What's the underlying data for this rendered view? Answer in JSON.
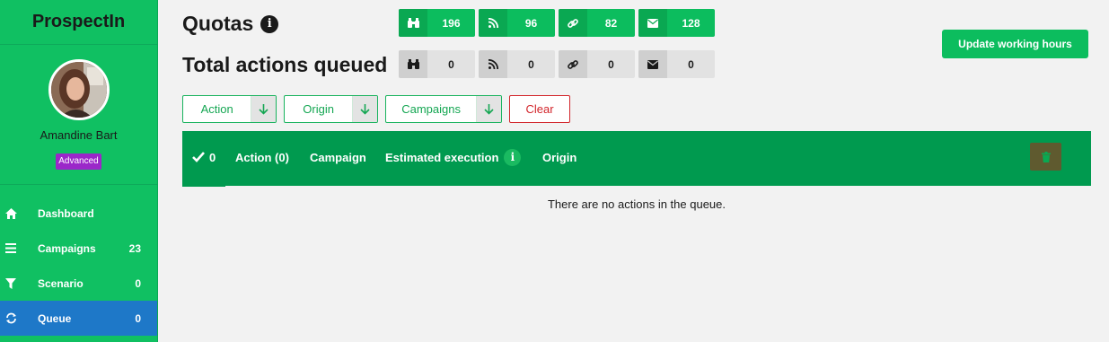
{
  "app": {
    "brand": "ProspectIn"
  },
  "profile": {
    "name": "Amandine Bart",
    "plan": "Advanced"
  },
  "nav": [
    {
      "label": "Dashboard",
      "count": "",
      "icon": "home-icon"
    },
    {
      "label": "Campaigns",
      "count": "23",
      "icon": "list-icon"
    },
    {
      "label": "Scenario",
      "count": "0",
      "icon": "filter-icon"
    },
    {
      "label": "Queue",
      "count": "0",
      "icon": "refresh-icon",
      "active": true
    }
  ],
  "quotas": {
    "title": "Quotas",
    "info": "i",
    "items": [
      {
        "icon": "binoculars-icon",
        "value": "196"
      },
      {
        "icon": "rss-icon",
        "value": "96"
      },
      {
        "icon": "link-icon",
        "value": "82"
      },
      {
        "icon": "envelope-icon",
        "value": "128"
      }
    ]
  },
  "queued": {
    "title": "Total actions queued",
    "items": [
      {
        "icon": "binoculars-icon",
        "value": "0"
      },
      {
        "icon": "rss-icon",
        "value": "0"
      },
      {
        "icon": "link-icon",
        "value": "0"
      },
      {
        "icon": "envelope-icon",
        "value": "0"
      }
    ]
  },
  "update_button": "Update working hours",
  "filters": {
    "action": "Action",
    "origin": "Origin",
    "campaigns": "Campaigns",
    "clear": "Clear"
  },
  "table": {
    "selected_count": "0",
    "col_action": "Action (0)",
    "col_campaign": "Campaign",
    "col_estimated": "Estimated execution",
    "col_origin": "Origin",
    "info": "i",
    "empty": "There are no actions in the queue."
  },
  "colors": {
    "sidebar": "#10c062",
    "accent": "#0cbd5e",
    "table_header": "#009a4f",
    "active_nav": "#1e78c8",
    "badge": "#9b27c9",
    "danger": "#d2242a"
  }
}
